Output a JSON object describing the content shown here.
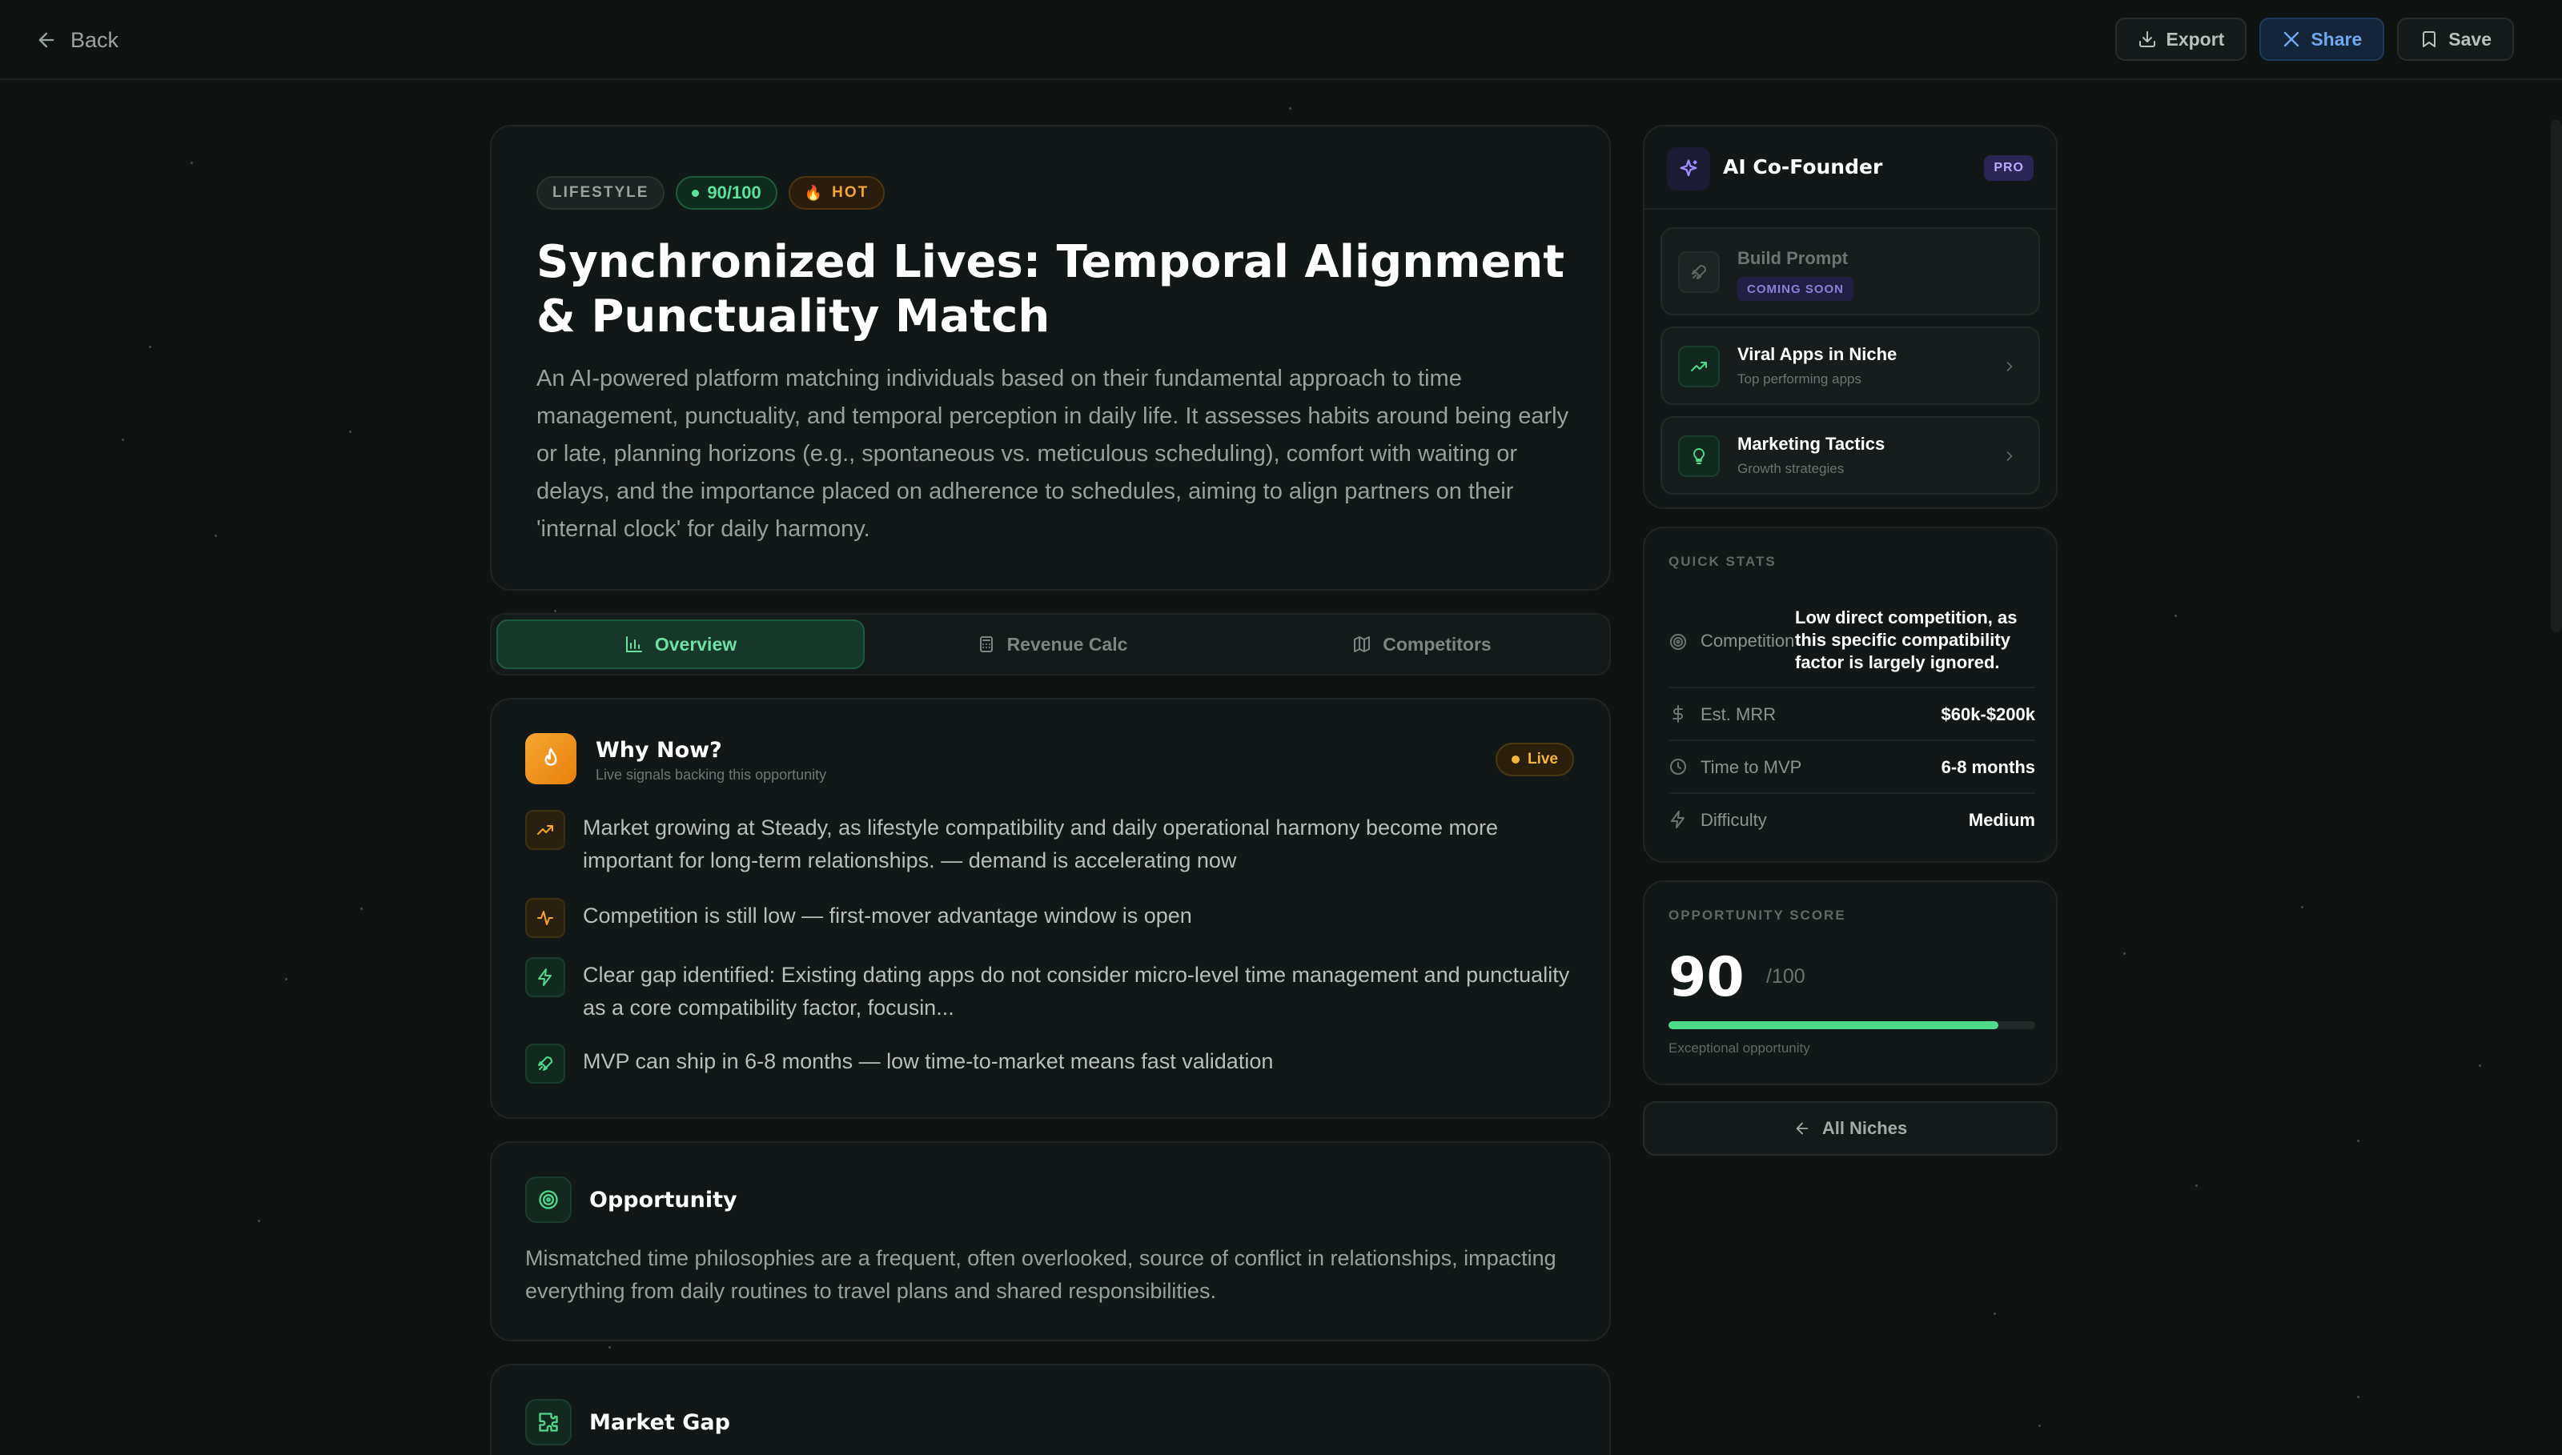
{
  "topbar": {
    "back_label": "Back",
    "export_label": "Export",
    "share_label": "Share",
    "save_label": "Save"
  },
  "hero": {
    "badge_category": "LIFESTYLE",
    "badge_score": "90/100",
    "badge_hot": "HOT",
    "title": "Synchronized Lives: Temporal Alignment & Punctuality Match",
    "description": "An AI-powered platform matching individuals based on their fundamental approach to time management, punctuality, and temporal perception in daily life. It assesses habits around being early or late, planning horizons (e.g., spontaneous vs. meticulous scheduling), comfort with waiting or delays, and the importance placed on adherence to schedules, aiming to align partners on their 'internal clock' for daily harmony."
  },
  "tabs": [
    {
      "label": "Overview",
      "icon": "bar-chart-icon",
      "active": true
    },
    {
      "label": "Revenue Calc",
      "icon": "calculator-icon",
      "active": false
    },
    {
      "label": "Competitors",
      "icon": "map-icon",
      "active": false
    }
  ],
  "why_now": {
    "title": "Why Now?",
    "subtitle": "Live signals backing this opportunity",
    "live_label": "Live",
    "signals": [
      {
        "icon": "trending-up-icon",
        "text": "Market growing at Steady, as lifestyle compatibility and daily operational harmony become more important for long-term relationships. — demand is accelerating now"
      },
      {
        "icon": "activity-icon",
        "text": "Competition is still low — first-mover advantage window is open"
      },
      {
        "icon": "zap-icon",
        "text": "Clear gap identified: Existing dating apps do not consider micro-level time management and punctuality as a core compatibility factor, focusin..."
      },
      {
        "icon": "rocket-icon",
        "text": "MVP can ship in 6-8 months — low time-to-market means fast validation"
      }
    ]
  },
  "opportunity": {
    "title": "Opportunity",
    "text": "Mismatched time philosophies are a frequent, often overlooked, source of conflict in relationships, impacting everything from daily routines to travel plans and shared responsibilities."
  },
  "market_gap": {
    "title": "Market Gap"
  },
  "cofounder": {
    "title": "AI Co-Founder",
    "pro_label": "PRO",
    "items": [
      {
        "title": "Build Prompt",
        "badge": "COMING SOON"
      },
      {
        "title": "Viral Apps in Niche",
        "subtitle": "Top performing apps"
      },
      {
        "title": "Marketing Tactics",
        "subtitle": "Growth strategies"
      }
    ]
  },
  "quick_stats": {
    "label": "QUICK STATS",
    "rows": [
      {
        "key": "Competition",
        "value": "Low direct competition, as this specific compatibility factor is largely ignored."
      },
      {
        "key": "Est. MRR",
        "value": "$60k-$200k"
      },
      {
        "key": "Time to MVP",
        "value": "6-8 months"
      },
      {
        "key": "Difficulty",
        "value": "Medium"
      }
    ]
  },
  "opportunity_score": {
    "label": "OPPORTUNITY SCORE",
    "value": "90",
    "denominator": "/100",
    "progress": 0.9,
    "caption": "Exceptional opportunity"
  },
  "all_niches_label": "All Niches",
  "colors": {
    "accent_green": "#4ed98b",
    "hot_orange": "#f5a531",
    "share_blue": "#6fa8ef",
    "pro_purple": "#b7a9ff"
  }
}
